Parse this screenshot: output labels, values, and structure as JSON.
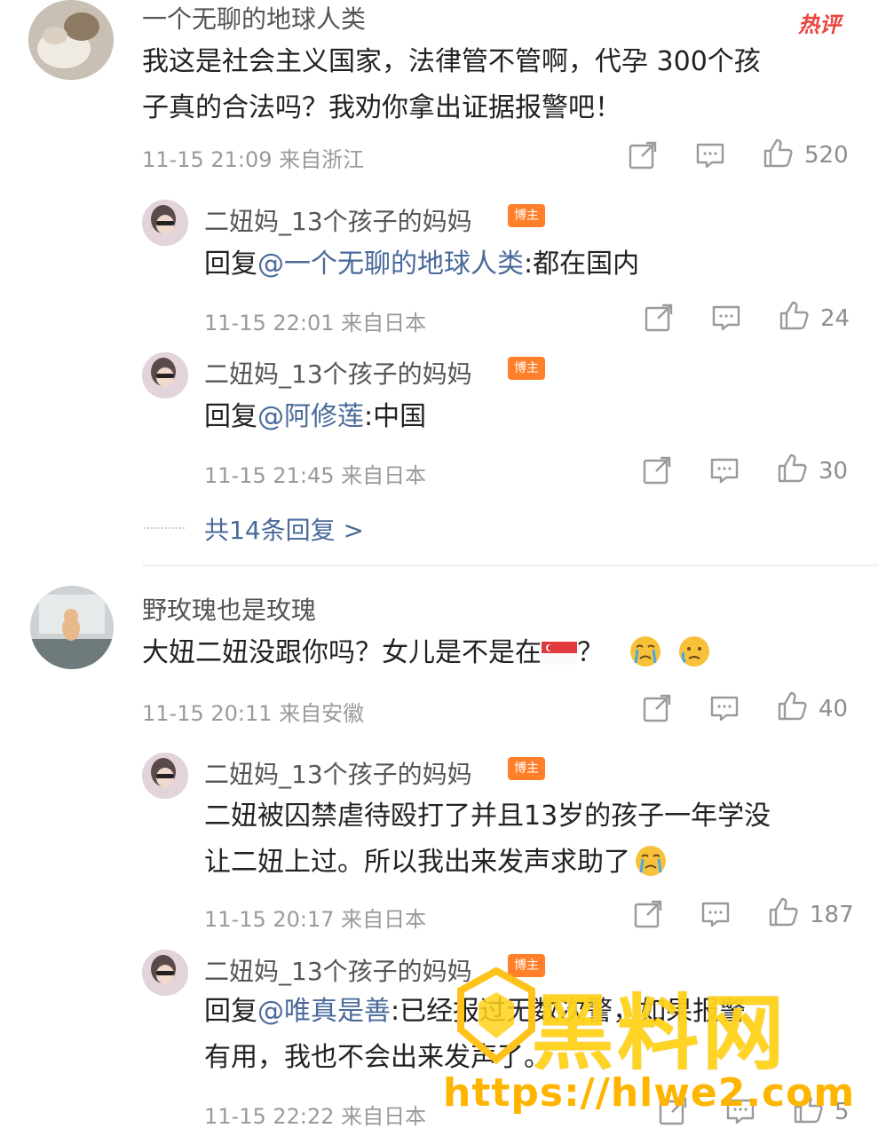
{
  "hot_label": "热评",
  "reply_badge": "博主",
  "threads": [
    {
      "user": "一个无聊的地球人类",
      "text_line1": "我这是社会主义国家，法律管不管啊，代孕 300个孩",
      "text_line2": "子真的合法吗？我劝你拿出证据报警吧！",
      "meta": "11-15 21:09 来自浙江",
      "likes": "520",
      "replies": [
        {
          "user": "二妞妈_13个孩子的妈妈",
          "prefix": "回复",
          "mention": "@一个无聊的地球人类",
          "content": ":都在国内",
          "meta": "11-15 22:01 来自日本",
          "likes": "24"
        },
        {
          "user": "二妞妈_13个孩子的妈妈",
          "prefix": "回复",
          "mention": "@阿修莲",
          "content": ":中国",
          "meta": "11-15 21:45 来自日本",
          "likes": "30"
        }
      ],
      "more_replies": "共14条回复 >"
    },
    {
      "user": "野玫瑰也是玫瑰",
      "text_before_flag": "大妞二妞没跟你吗？女儿是不是在",
      "text_after_flag": "？",
      "meta": "11-15 20:11 来自安徽",
      "likes": "40",
      "replies": [
        {
          "user": "二妞妈_13个孩子的妈妈",
          "line1": "二妞被囚禁虐待殴打了并且13岁的孩子一年学没",
          "line2": "让二妞上过。所以我出来发声求助了",
          "meta": "11-15 20:17 来自日本",
          "likes": "187"
        },
        {
          "user": "二妞妈_13个孩子的妈妈",
          "prefix": "回复",
          "mention": "@唯真是善",
          "content": ":已经报过无数次警，如果报警",
          "line2": "有用，我也不会出来发声了。",
          "meta": "11-15 22:22 来自日本",
          "likes": "5"
        }
      ]
    }
  ],
  "watermark": {
    "title": "黑料网",
    "url": "https://hlwe2.com"
  }
}
